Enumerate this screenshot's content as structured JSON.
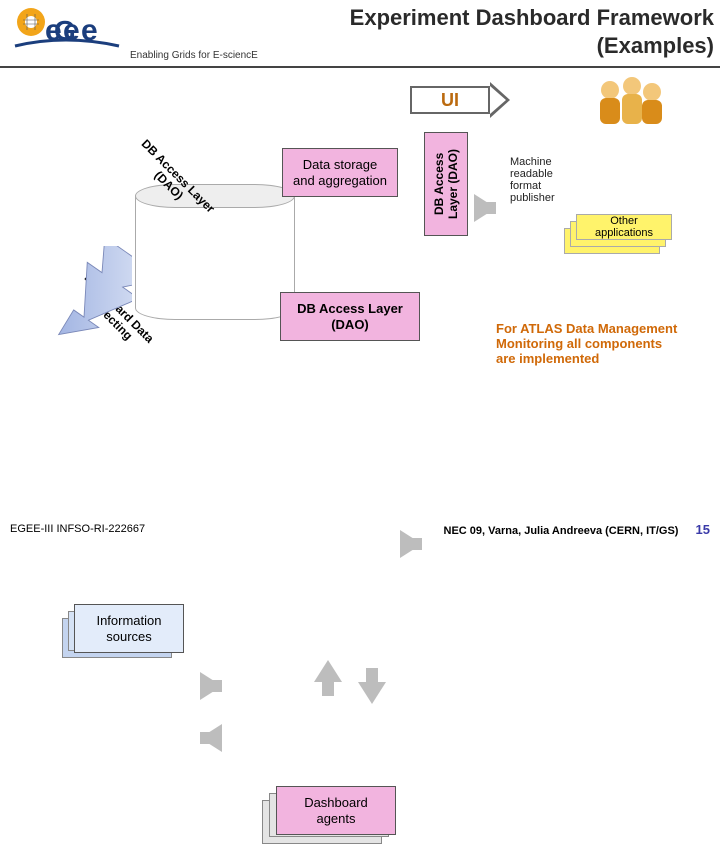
{
  "header": {
    "tagline": "Enabling Grids for E-sciencE",
    "title_line1": "Experiment Dashboard Framework",
    "title_line2": "(Examples)"
  },
  "diagram": {
    "ui_arrow": "UI",
    "dao_vertical": "DB Access\nLayer (DAO)",
    "machine_readable": "Machine readable format publisher",
    "other_apps": "Other applications",
    "data_storage": "Data storage and aggregation",
    "db_access_layer_cyl_label": "DB Access Layer (DAO)",
    "dao_lower": "DB Access Layer (DAO)",
    "dashboard_collecting": "Dashboard Data Collecting",
    "dashboard_agents_src": "Dashboard Agents",
    "information_sources": "Information sources",
    "dashboard_agents": "Dashboard agents",
    "atlas_note": "For ATLAS Data Management Monitoring all components are implemented"
  },
  "footer": {
    "left": "EGEE-III INFSO-RI-222667",
    "right": "NEC 09, Varna,  Julia Andreeva (CERN, IT/GS)",
    "page": "15"
  }
}
